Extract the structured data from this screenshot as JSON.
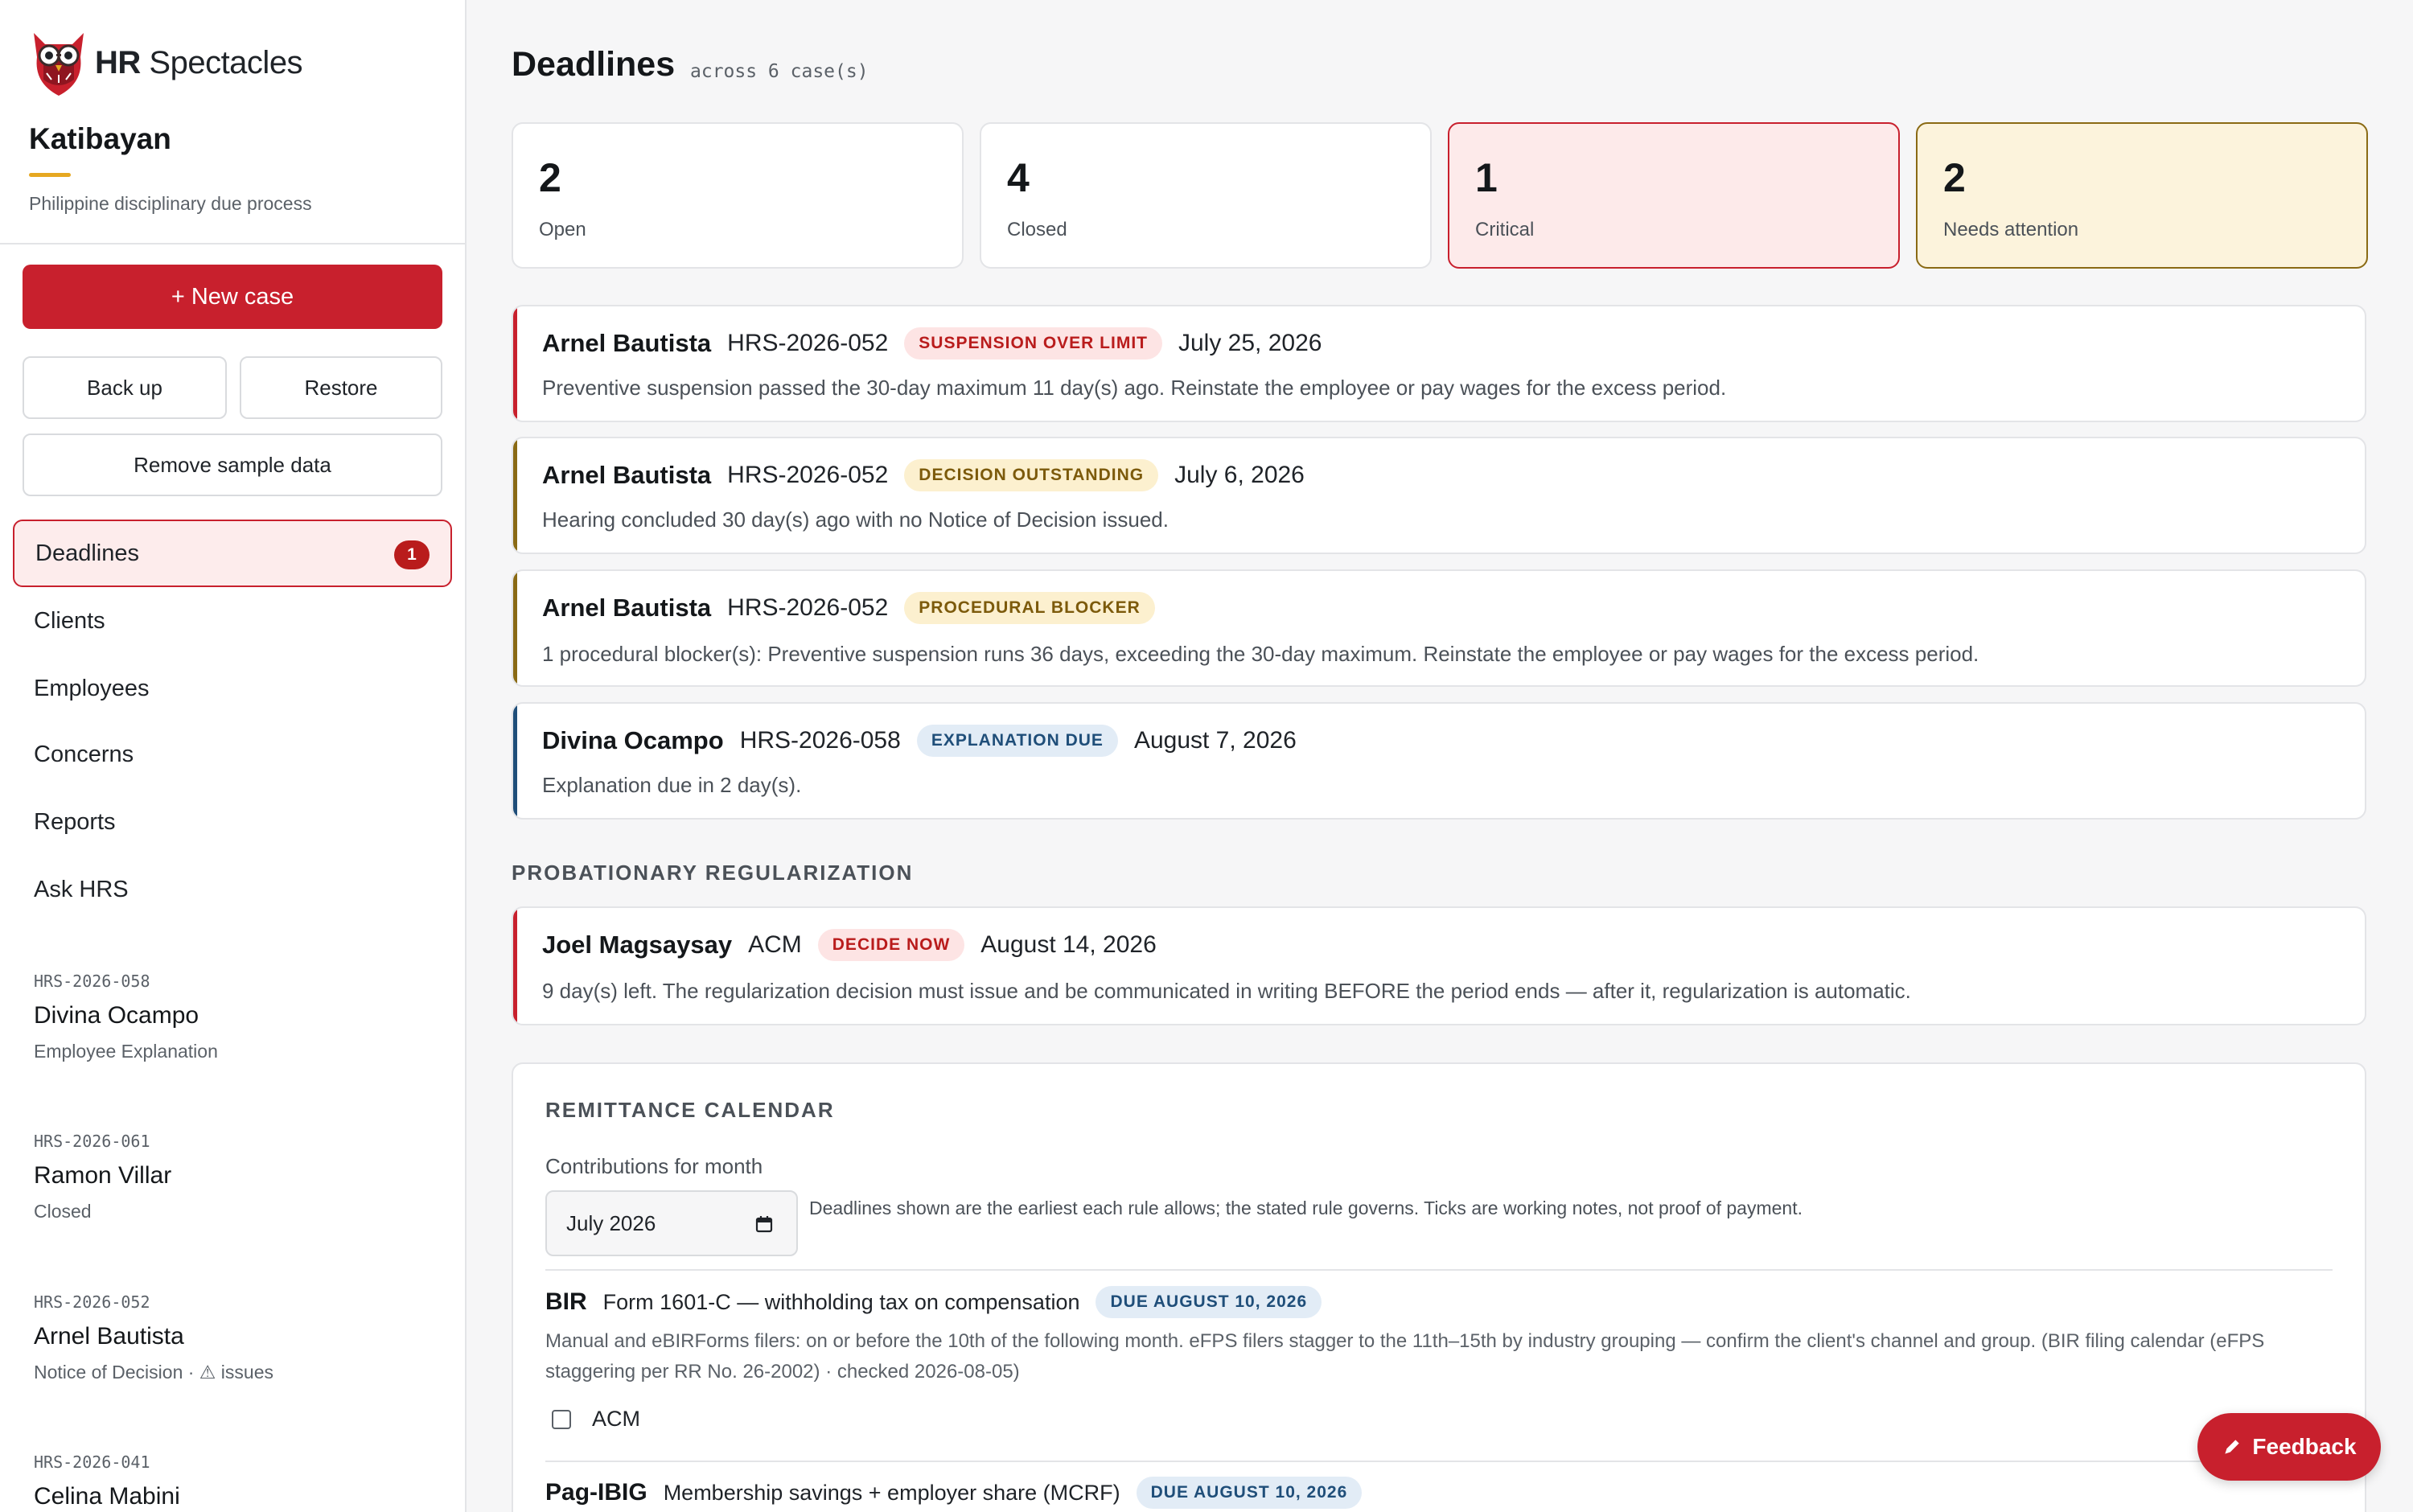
{
  "brand": {
    "name_bold": "HR",
    "name_rest": " Spectacles"
  },
  "org": {
    "name": "Katibayan",
    "subtitle": "Philippine disciplinary due process"
  },
  "actions": {
    "new_case": "+ New case",
    "back_up": "Back up",
    "restore": "Restore",
    "remove_sample": "Remove sample data"
  },
  "nav": [
    {
      "label": "Deadlines",
      "badge": "1",
      "active": true
    },
    {
      "label": "Clients"
    },
    {
      "label": "Employees"
    },
    {
      "label": "Concerns"
    },
    {
      "label": "Reports"
    },
    {
      "label": "Ask HRS"
    }
  ],
  "cases": [
    {
      "code": "HRS-2026-058",
      "name": "Divina Ocampo",
      "status": "Employee Explanation"
    },
    {
      "code": "HRS-2026-061",
      "name": "Ramon Villar",
      "status": "Closed"
    },
    {
      "code": "HRS-2026-052",
      "name": "Arnel Bautista",
      "status": "Notice of Decision · ⚠ issues"
    },
    {
      "code": "HRS-2026-041",
      "name": "Celina Mabini",
      "status": ""
    }
  ],
  "page": {
    "title": "Deadlines",
    "subtitle": "across 6 case(s)"
  },
  "stats": [
    {
      "value": "2",
      "label": "Open"
    },
    {
      "value": "4",
      "label": "Closed"
    },
    {
      "value": "1",
      "label": "Critical"
    },
    {
      "value": "2",
      "label": "Needs attention"
    }
  ],
  "alerts": [
    {
      "who": "Arnel Bautista",
      "code": "HRS-2026-052",
      "tag": "SUSPENSION OVER LIMIT",
      "severity": "critical",
      "date": "July 25, 2026",
      "desc": "Preventive suspension passed the 30-day maximum 11 day(s) ago. Reinstate the employee or pay wages for the excess period."
    },
    {
      "who": "Arnel Bautista",
      "code": "HRS-2026-052",
      "tag": "DECISION OUTSTANDING",
      "severity": "warning",
      "date": "July 6, 2026",
      "desc": "Hearing concluded 30 day(s) ago with no Notice of Decision issued."
    },
    {
      "who": "Arnel Bautista",
      "code": "HRS-2026-052",
      "tag": "PROCEDURAL BLOCKER",
      "severity": "warning",
      "date": "",
      "desc": "1 procedural blocker(s): Preventive suspension runs 36 days, exceeding the 30-day maximum. Reinstate the employee or pay wages for the excess period."
    },
    {
      "who": "Divina Ocampo",
      "code": "HRS-2026-058",
      "tag": "EXPLANATION DUE",
      "severity": "info",
      "date": "August 7, 2026",
      "desc": "Explanation due in 2 day(s)."
    }
  ],
  "probationary": {
    "heading": "PROBATIONARY REGULARIZATION",
    "items": [
      {
        "who": "Joel Magsaysay",
        "code": "ACM",
        "tag": "DECIDE NOW",
        "severity": "critical",
        "date": "August 14, 2026",
        "desc": "9 day(s) left. The regularization decision must issue and be communicated in writing BEFORE the period ends — after it, regularization is automatic."
      }
    ]
  },
  "remittance": {
    "heading": "REMITTANCE CALENDAR",
    "month_label": "Contributions for month",
    "month_value": "July 2026",
    "note": "Deadlines shown are the earliest each rule allows; the stated rule governs. Ticks are working notes, not proof of payment.",
    "items": [
      {
        "agency": "BIR",
        "form": "Form 1601-C — withholding tax on compensation",
        "due": "DUE AUGUST 10, 2026",
        "desc": "Manual and eBIRForms filers: on or before the 10th of the following month. eFPS filers stagger to the 11th–15th by industry grouping — confirm the client's channel and group. (BIR filing calendar (eFPS staggering per RR No. 26-2002) · checked 2026-08-05)",
        "check_label": "ACM",
        "checked": false
      },
      {
        "agency": "Pag-IBIG",
        "form": "Membership savings + employer share (MCRF)",
        "due": "DUE AUGUST 10, 2026"
      }
    ]
  },
  "feedback": {
    "label": "Feedback"
  },
  "colors": {
    "accent": "#c8202d",
    "critical": "#c8202d",
    "warning": "#8a6a14",
    "info": "#1f4e79"
  }
}
